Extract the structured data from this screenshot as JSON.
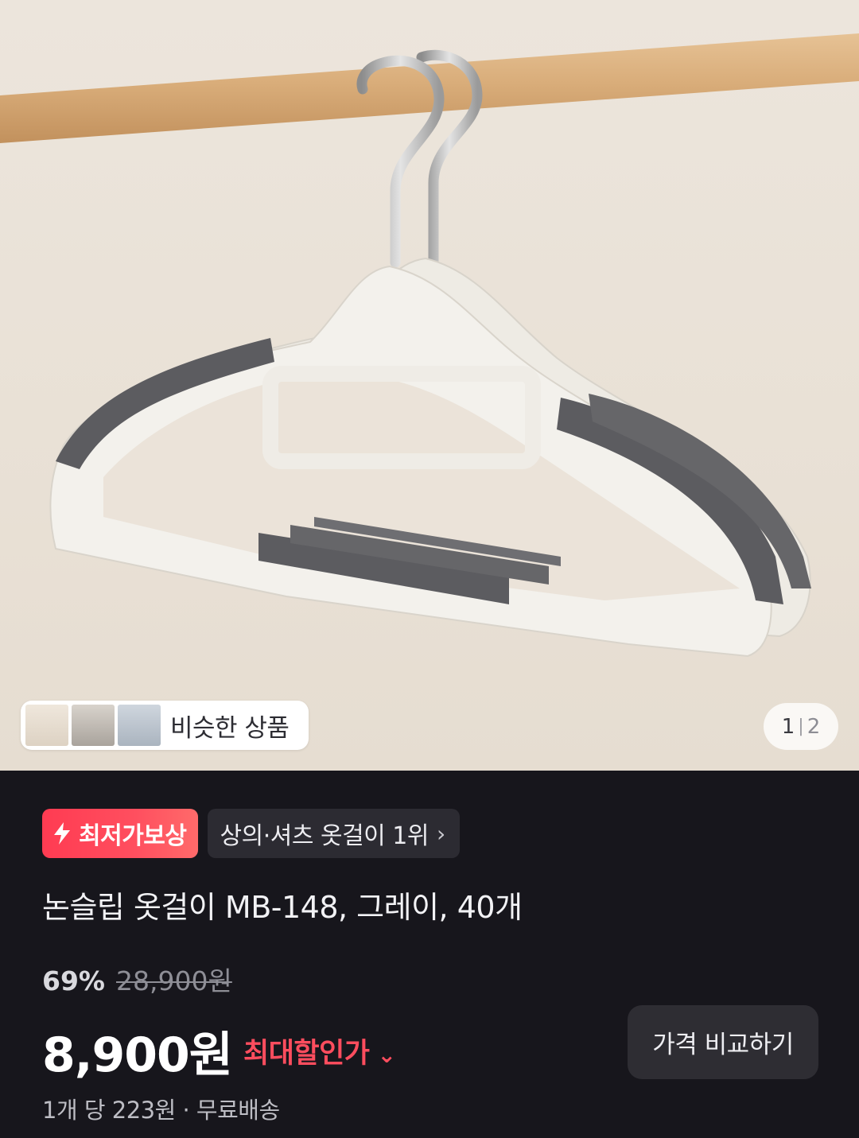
{
  "gallery": {
    "similar_label": "비슷한 상품",
    "current_page": "1",
    "separator": "|",
    "total_pages": "2"
  },
  "badges": {
    "lowest_price_label": "최저가보상",
    "lowest_price_icon": "lightning-bolt-icon",
    "rank_label": "상의·셔츠 옷걸이 1위",
    "rank_chevron": "›"
  },
  "product": {
    "title": "논슬립 옷걸이 MB-148, 그레이, 40개",
    "discount_rate": "69%",
    "original_price": "28,900원",
    "price": "8,900원",
    "max_discount_label": "최대할인가",
    "max_discount_chevron": "⌄",
    "compare_button_label": "가격 비교하기",
    "unit_info": "1개 당 223원 · 무료배송"
  },
  "colors": {
    "background": "#17161c",
    "accent_red": "#ff4d5e",
    "badge_dark": "#2c2b32"
  }
}
